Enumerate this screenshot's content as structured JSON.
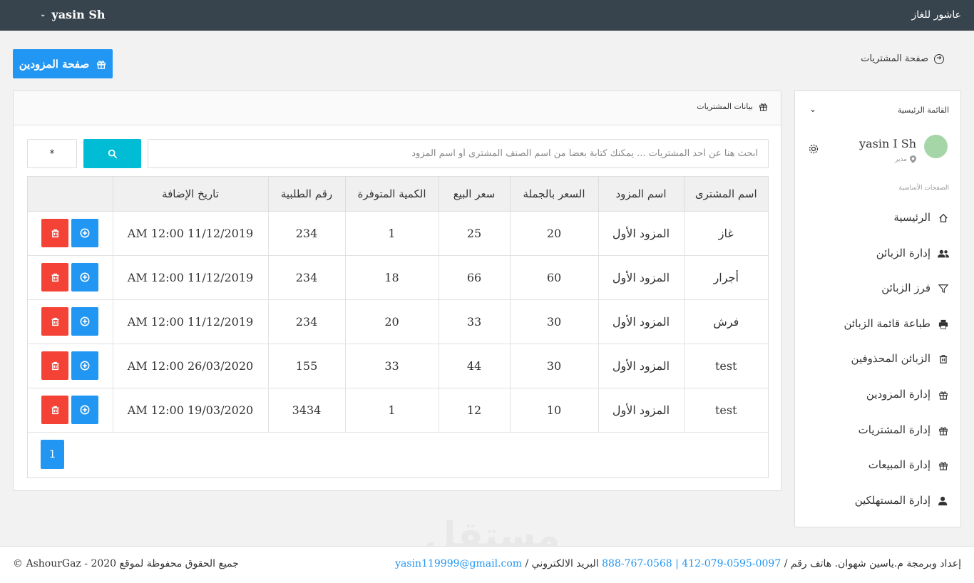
{
  "app": {
    "brand": "عاشور للغاز",
    "user_menu": "yasin Sh"
  },
  "top_actions": {
    "suppliers_button": "صفحة المزودين",
    "back_link": "صفحة المشتريات"
  },
  "sidebar": {
    "menu_title": "القائمة الرئيسية",
    "user_name": "yasin I Sh",
    "user_role": "مدير",
    "section_label": "الصفحات الأساسية",
    "items": [
      {
        "label": "الرئيسية",
        "icon": "home-icon"
      },
      {
        "label": "إدارة الزبائن",
        "icon": "users-icon"
      },
      {
        "label": "فرز الزبائن",
        "icon": "filter-icon"
      },
      {
        "label": "طباعة قائمة الزبائن",
        "icon": "print-icon"
      },
      {
        "label": "الزبائن المحذوفين",
        "icon": "trash-icon"
      },
      {
        "label": "إدارة المزودين",
        "icon": "gift-icon"
      },
      {
        "label": "إدارة المشتريات",
        "icon": "gift-icon"
      },
      {
        "label": "إدارة المبيعات",
        "icon": "gift-icon"
      },
      {
        "label": "إدارة المستهلكين",
        "icon": "user-icon"
      }
    ]
  },
  "panel": {
    "title": "بيانات المشتريات",
    "search_placeholder": "ابحث هنا عن أحد المشتريات ... يمكنك كتابة بعضاً من اسم الصنف المشترى أو اسم المزود",
    "star_label": "*",
    "columns": [
      "اسم المشترى",
      "اسم المزود",
      "السعر بالجملة",
      "سعر البيع",
      "الكمية المتوفرة",
      "رقم الطلبية",
      "تاريخ الإضافة",
      ""
    ],
    "rows": [
      [
        "غاز",
        "المزود الأول",
        "20",
        "25",
        "1",
        "234",
        "AM 12:00 11/12/2019"
      ],
      [
        "أجرار",
        "المزود الأول",
        "60",
        "66",
        "18",
        "234",
        "AM 12:00 11/12/2019"
      ],
      [
        "فرش",
        "المزود الأول",
        "30",
        "33",
        "20",
        "234",
        "AM 12:00 11/12/2019"
      ],
      [
        "test",
        "المزود الأول",
        "30",
        "44",
        "33",
        "155",
        "AM 12:00 26/03/2020"
      ],
      [
        "test",
        "المزود الأول",
        "10",
        "12",
        "1",
        "3434",
        "AM 12:00 19/03/2020"
      ]
    ],
    "page": "1"
  },
  "footer": {
    "credit_prefix": "إعداد وبرمجة م.ياسين شهوان. هاتف رقم /",
    "phones": "0097-0595-079-412 | 0568-767-888",
    "email_label": "البريد الالكتروني /",
    "email": "yasin119999@gmail.com",
    "copyright": "جميع الحقوق محفوظة لموقع 2020 - AshourGaz ©"
  },
  "watermark": "مستقل",
  "colors": {
    "topbar": "#38444d",
    "primary": "#2196f3",
    "cyan": "#00bcd4",
    "danger": "#f44336",
    "avatar": "#a5d6a7"
  }
}
